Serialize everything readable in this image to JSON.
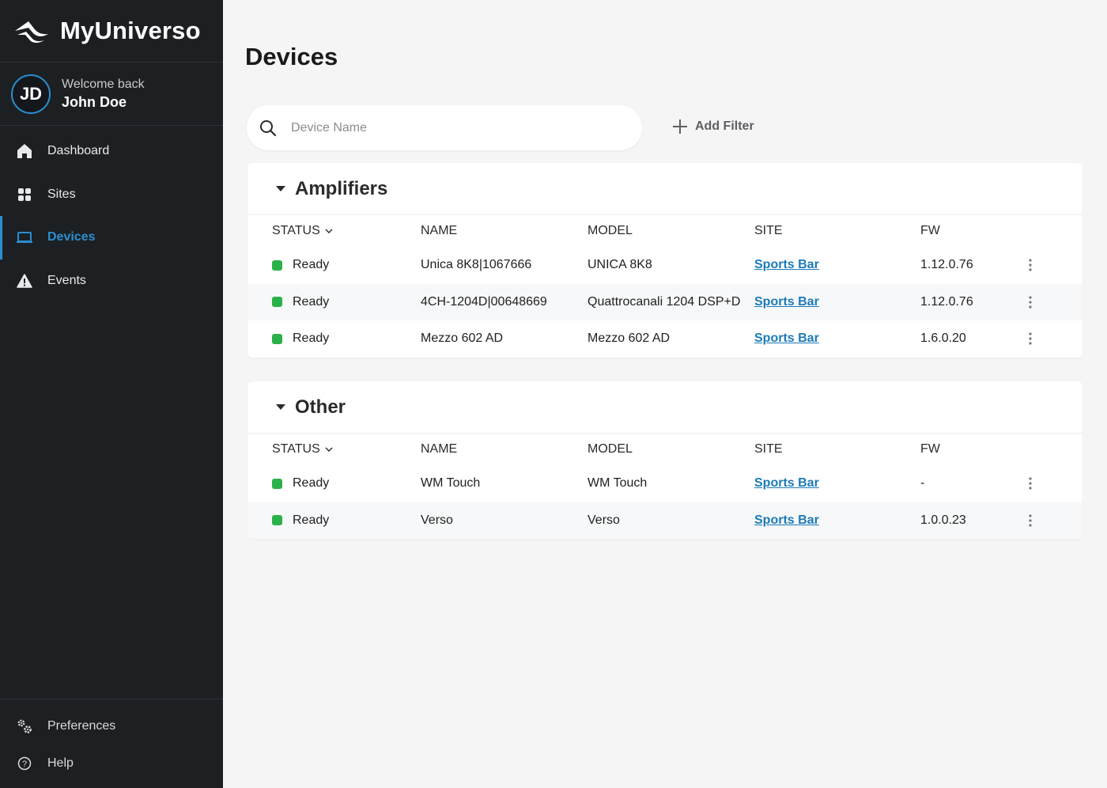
{
  "app": {
    "name": "MyUniverso"
  },
  "user": {
    "initials": "JD",
    "welcome": "Welcome back",
    "name": "John Doe"
  },
  "nav": [
    {
      "label": "Dashboard",
      "icon": "home-icon",
      "active": false
    },
    {
      "label": "Sites",
      "icon": "grid-icon",
      "active": false
    },
    {
      "label": "Devices",
      "icon": "device-icon",
      "active": true
    },
    {
      "label": "Events",
      "icon": "warning-icon",
      "active": false
    }
  ],
  "nav_bottom": [
    {
      "label": "Preferences",
      "icon": "gears-icon"
    },
    {
      "label": "Help",
      "icon": "help-icon"
    }
  ],
  "page": {
    "title": "Devices"
  },
  "search": {
    "placeholder": "Device Name",
    "value": ""
  },
  "add_filter": {
    "label": "Add Filter"
  },
  "columns": {
    "status": "STATUS",
    "name": "NAME",
    "model": "MODEL",
    "site": "SITE",
    "fw": "FW"
  },
  "groups": [
    {
      "title": "Amplifiers",
      "rows": [
        {
          "status": "Ready",
          "name": "Unica 8K8|1067666",
          "model": "UNICA 8K8",
          "site": "Sports Bar",
          "fw": "1.12.0.76"
        },
        {
          "status": "Ready",
          "name": "4CH-1204D|00648669",
          "model": "Quattrocanali 1204 DSP+D",
          "site": "Sports Bar",
          "fw": "1.12.0.76"
        },
        {
          "status": "Ready",
          "name": "Mezzo 602 AD",
          "model": "Mezzo 602 AD",
          "site": "Sports Bar",
          "fw": "1.6.0.20"
        }
      ]
    },
    {
      "title": "Other",
      "rows": [
        {
          "status": "Ready",
          "name": "WM Touch",
          "model": "WM Touch",
          "site": "Sports Bar",
          "fw": "-"
        },
        {
          "status": "Ready",
          "name": "Verso",
          "model": "Verso",
          "site": "Sports Bar",
          "fw": "1.0.0.23"
        }
      ]
    }
  ],
  "colors": {
    "accent": "#2a8ed1",
    "sidebar": "#1d2023",
    "status_ready": "#2bb14a",
    "link": "#1c7ab8"
  }
}
